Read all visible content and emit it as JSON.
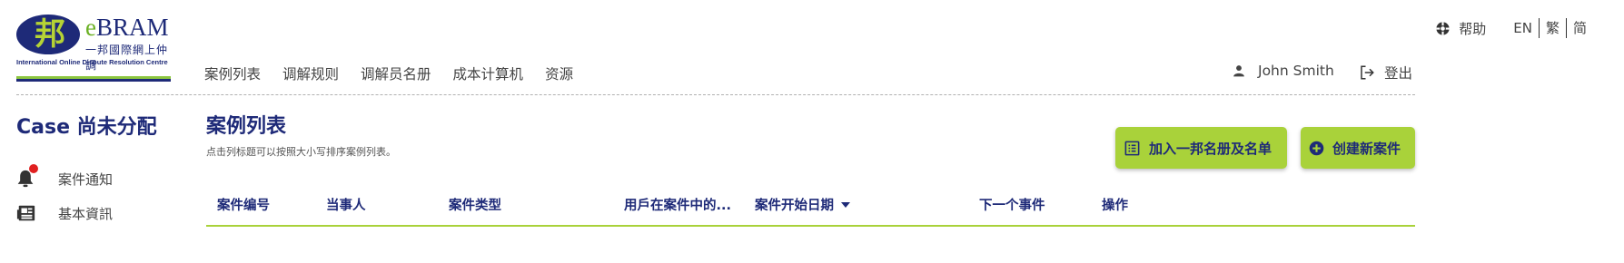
{
  "header": {
    "logo": {
      "brand_e": "e",
      "brand_rest": "BRAM",
      "glyph": "邦",
      "subtitle": "一邦國際網上仲調",
      "tagline": "International Online Dispute Resolution Centre"
    },
    "nav": [
      {
        "label": "案例列表"
      },
      {
        "label": "调解规则"
      },
      {
        "label": "调解员名册"
      },
      {
        "label": "成本计算机"
      },
      {
        "label": "资源"
      }
    ],
    "help_label": "帮助",
    "languages": [
      "EN",
      "繁",
      "简"
    ],
    "user_name": "John Smith",
    "logout_label": "登出"
  },
  "sidebar": {
    "case_title": "Case 尚未分配",
    "items": [
      {
        "label": "案件通知",
        "icon": "bell-icon"
      },
      {
        "label": "基本資訊",
        "icon": "info-card-icon"
      }
    ]
  },
  "main": {
    "title": "案例列表",
    "hint": "点击列标题可以按照大小写排序案例列表。",
    "buttons": {
      "join": "加入一邦名册及名单",
      "create": "创建新案件"
    },
    "columns": [
      {
        "label": "案件编号"
      },
      {
        "label": "当事人"
      },
      {
        "label": "案件类型"
      },
      {
        "label": "用戶在案件中的..."
      },
      {
        "label": "案件开始日期"
      },
      {
        "label": "下一个事件"
      },
      {
        "label": "操作"
      }
    ]
  },
  "colors": {
    "navy": "#1e2a78",
    "accent_green": "#a9d23a",
    "notification_dot": "#e02020"
  }
}
